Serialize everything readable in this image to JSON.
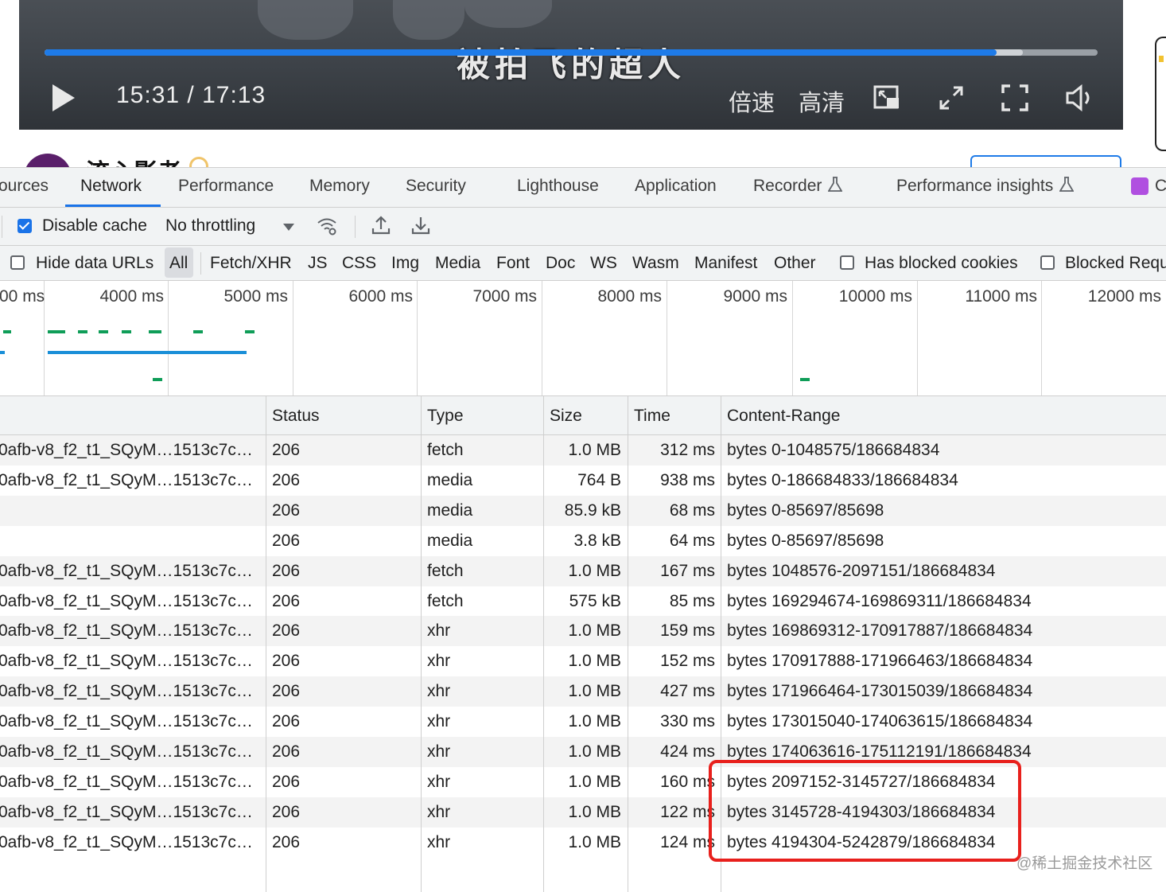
{
  "player": {
    "subtitle": "被拍飞的超人",
    "time": "15:31 / 17:13",
    "progress_played": 0.904,
    "progress_buffered": 0.929,
    "speed_label": "倍速",
    "quality_label": "高清",
    "icons": [
      "play-icon",
      "picture-in-picture-icon",
      "fullscreen-web-icon",
      "fullscreen-icon",
      "volume-icon"
    ]
  },
  "channel": {
    "name": "流心影者"
  },
  "devtools": {
    "tabs": [
      {
        "label": "ources"
      },
      {
        "label": "Network",
        "active": true
      },
      {
        "label": "Performance"
      },
      {
        "label": "Memory"
      },
      {
        "label": "Security"
      },
      {
        "label": "Lighthouse"
      },
      {
        "label": "Application"
      },
      {
        "label": "Recorder"
      },
      {
        "label": "Performance insights"
      },
      {
        "label": "C"
      }
    ],
    "toolbar": {
      "disable_cache_label": "Disable cache",
      "disable_cache_checked": true,
      "throttling": "No throttling"
    },
    "filters": {
      "hide_data_urls": "Hide data URLs",
      "types": [
        "All",
        "Fetch/XHR",
        "JS",
        "CSS",
        "Img",
        "Media",
        "Font",
        "Doc",
        "WS",
        "Wasm",
        "Manifest",
        "Other"
      ],
      "active_type": "All",
      "has_blocked_cookies": "Has blocked cookies",
      "blocked_requests": "Blocked Requ"
    },
    "overview_ticks": [
      "00 ms",
      "4000 ms",
      "5000 ms",
      "6000 ms",
      "7000 ms",
      "8000 ms",
      "9000 ms",
      "10000 ms",
      "11000 ms",
      "12000 ms"
    ],
    "columns": [
      "Status",
      "Type",
      "Size",
      "Time",
      "Content-Range"
    ],
    "rows": [
      {
        "name": "0afb-v8_f2_t1_SQyM…1513c7c…",
        "status": "206",
        "type": "fetch",
        "size": "1.0 MB",
        "time": "312 ms",
        "range": "bytes 0-1048575/186684834"
      },
      {
        "name": "0afb-v8_f2_t1_SQyM…1513c7c…",
        "status": "206",
        "type": "media",
        "size": "764 B",
        "time": "938 ms",
        "range": "bytes 0-186684833/186684834"
      },
      {
        "name": "",
        "status": "206",
        "type": "media",
        "size": "85.9 kB",
        "time": "68 ms",
        "range": "bytes 0-85697/85698"
      },
      {
        "name": "",
        "status": "206",
        "type": "media",
        "size": "3.8 kB",
        "time": "64 ms",
        "range": "bytes 0-85697/85698"
      },
      {
        "name": "0afb-v8_f2_t1_SQyM…1513c7c…",
        "status": "206",
        "type": "fetch",
        "size": "1.0 MB",
        "time": "167 ms",
        "range": "bytes 1048576-2097151/186684834"
      },
      {
        "name": "0afb-v8_f2_t1_SQyM…1513c7c…",
        "status": "206",
        "type": "fetch",
        "size": "575 kB",
        "time": "85 ms",
        "range": "bytes 169294674-169869311/186684834"
      },
      {
        "name": "0afb-v8_f2_t1_SQyM…1513c7c…",
        "status": "206",
        "type": "xhr",
        "size": "1.0 MB",
        "time": "159 ms",
        "range": "bytes 169869312-170917887/186684834"
      },
      {
        "name": "0afb-v8_f2_t1_SQyM…1513c7c…",
        "status": "206",
        "type": "xhr",
        "size": "1.0 MB",
        "time": "152 ms",
        "range": "bytes 170917888-171966463/186684834"
      },
      {
        "name": "0afb-v8_f2_t1_SQyM…1513c7c…",
        "status": "206",
        "type": "xhr",
        "size": "1.0 MB",
        "time": "427 ms",
        "range": "bytes 171966464-173015039/186684834"
      },
      {
        "name": "0afb-v8_f2_t1_SQyM…1513c7c…",
        "status": "206",
        "type": "xhr",
        "size": "1.0 MB",
        "time": "330 ms",
        "range": "bytes 173015040-174063615/186684834"
      },
      {
        "name": "0afb-v8_f2_t1_SQyM…1513c7c…",
        "status": "206",
        "type": "xhr",
        "size": "1.0 MB",
        "time": "424 ms",
        "range": "bytes 174063616-175112191/186684834"
      },
      {
        "name": "0afb-v8_f2_t1_SQyM…1513c7c…",
        "status": "206",
        "type": "xhr",
        "size": "1.0 MB",
        "time": "160 ms",
        "range": "bytes 2097152-3145727/186684834"
      },
      {
        "name": "0afb-v8_f2_t1_SQyM…1513c7c…",
        "status": "206",
        "type": "xhr",
        "size": "1.0 MB",
        "time": "122 ms",
        "range": "bytes 3145728-4194303/186684834"
      },
      {
        "name": "0afb-v8_f2_t1_SQyM…1513c7c…",
        "status": "206",
        "type": "xhr",
        "size": "1.0 MB",
        "time": "124 ms",
        "range": "bytes 4194304-5242879/186684834"
      }
    ]
  },
  "annotation": {
    "highlight_color": "#e8201c"
  },
  "watermark": "@稀土掘金技术社区",
  "colors": {
    "accent": "#1a73e8",
    "waterfall_green": "#0f9d58",
    "waterfall_blue": "#1a8fd8"
  }
}
